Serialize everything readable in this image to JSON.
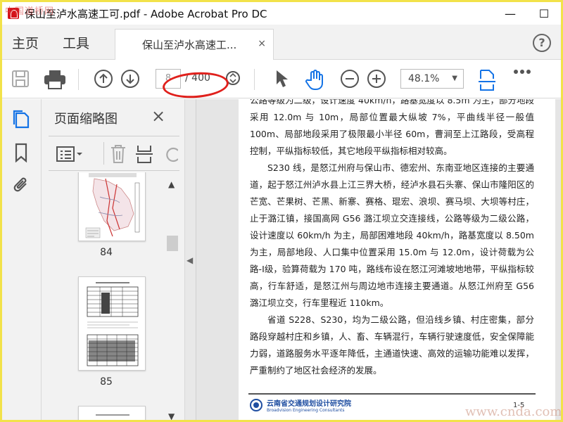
{
  "window": {
    "title": "保山至泸水高速工可.pdf - Adobe Acrobat Pro DC",
    "minimize": "—",
    "maximize": "☐"
  },
  "watermarks": {
    "top_left": "中国道桥网",
    "bottom_right": "www.cnda.com"
  },
  "menu": {
    "home": "主页",
    "tools": "工具",
    "doc_tab": "保山至泸水高速工...",
    "doc_tab_close": "×",
    "help": "?"
  },
  "toolbar": {
    "page_current": "8",
    "page_total": "/ 400",
    "zoom": "48.1%"
  },
  "thumbnail_panel": {
    "title": "页面缩略图",
    "close": "×",
    "thumbnails": [
      {
        "page_label": "84"
      },
      {
        "page_label": "85"
      }
    ]
  },
  "document": {
    "paragraphs": [
      {
        "text": "公路等级为二级，设计速度 40km/h，路基宽度以 8.5m 为主，部分地段采用 12.0m 与 10m，局部位置最大纵坡 7%，平曲线半径一般值 100m、局部地段采用了极限最小半径 60m，曹涧至上江路段，受高程控制，平纵指标较低，其它地段平纵指标相对较高。",
        "indent": false
      },
      {
        "text": "S230 线，是怒江州府与保山市、德宏州、东南亚地区连接的主要通道，起于怒江州泸水县上江三界大桥，经泸水县石头寨、保山市隆阳区的芒宽、芒果树、芒黑、新寨、赛格、琨宏、浪坝、赛马坝、大坝等村庄，止于潞江镇，接国高网 G56 潞江坝立交连接线，公路等级为二级公路，设计速度以 60km/h 为主，局部困难地段 40km/h，路基宽度以 8.50m 为主，局部地段、人口集中位置采用 15.0m 与 12.0m，设计荷载为公路-Ⅰ级，验算荷载为 170 吨，路线布设在怒江河滩坡地地带，平纵指标较高，行车舒适，是怒江州与周边地市连接主要通道。从怒江州府至 G56 潞江坝立交，行车里程近 110km。",
        "indent": true
      },
      {
        "text": "省道 S228、S230，均为二级公路，但沿线乡镇、村庄密集，部分路段穿越村庄和乡镇，人、畜、车辆混行，车辆行驶速度低，安全保障能力弱，道路服务水平逐年降低，主通道快速、高效的运输功能难以发挥，严重制约了地区社会经济的发展。",
        "indent": true
      }
    ],
    "footer": {
      "org_cn": "云南省交通规划设计研究院",
      "org_en": "Broadvision Engineering Consultants",
      "page_number": "1-5"
    }
  },
  "colors": {
    "acrobat_blue": "#1473e6",
    "annotation_red": "#e0201c",
    "frame_yellow": "#f2e24a"
  }
}
